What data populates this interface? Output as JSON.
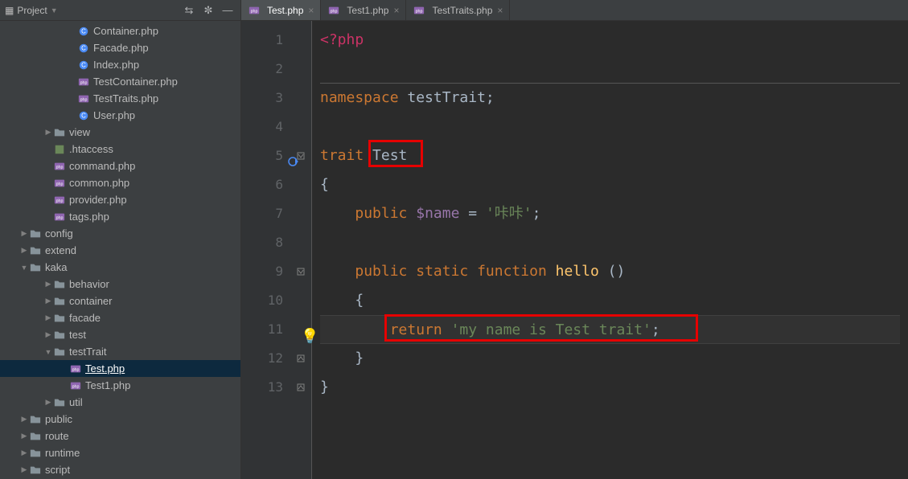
{
  "sidebar": {
    "title": "Project",
    "tree": [
      {
        "indent": 80,
        "icon": "class",
        "label": "Container.php",
        "arrow": ""
      },
      {
        "indent": 80,
        "icon": "class",
        "label": "Facade.php",
        "arrow": ""
      },
      {
        "indent": 80,
        "icon": "class",
        "label": "Index.php",
        "arrow": ""
      },
      {
        "indent": 80,
        "icon": "php",
        "label": "TestContainer.php",
        "arrow": ""
      },
      {
        "indent": 80,
        "icon": "php",
        "label": "TestTraits.php",
        "arrow": ""
      },
      {
        "indent": 80,
        "icon": "class",
        "label": "User.php",
        "arrow": ""
      },
      {
        "indent": 50,
        "icon": "folder",
        "label": "view",
        "arrow": "▶"
      },
      {
        "indent": 50,
        "icon": "htaccess",
        "label": ".htaccess",
        "arrow": ""
      },
      {
        "indent": 50,
        "icon": "php",
        "label": "command.php",
        "arrow": ""
      },
      {
        "indent": 50,
        "icon": "php",
        "label": "common.php",
        "arrow": ""
      },
      {
        "indent": 50,
        "icon": "php",
        "label": "provider.php",
        "arrow": ""
      },
      {
        "indent": 50,
        "icon": "php",
        "label": "tags.php",
        "arrow": ""
      },
      {
        "indent": 20,
        "icon": "folder",
        "label": "config",
        "arrow": "▶"
      },
      {
        "indent": 20,
        "icon": "folder",
        "label": "extend",
        "arrow": "▶"
      },
      {
        "indent": 20,
        "icon": "folder",
        "label": "kaka",
        "arrow": "▼"
      },
      {
        "indent": 50,
        "icon": "folder",
        "label": "behavior",
        "arrow": "▶"
      },
      {
        "indent": 50,
        "icon": "folder",
        "label": "container",
        "arrow": "▶"
      },
      {
        "indent": 50,
        "icon": "folder",
        "label": "facade",
        "arrow": "▶"
      },
      {
        "indent": 50,
        "icon": "folder",
        "label": "test",
        "arrow": "▶"
      },
      {
        "indent": 50,
        "icon": "folder",
        "label": "testTrait",
        "arrow": "▼"
      },
      {
        "indent": 70,
        "icon": "php",
        "label": "Test.php",
        "arrow": "",
        "selected": true,
        "underline": true
      },
      {
        "indent": 70,
        "icon": "php",
        "label": "Test1.php",
        "arrow": ""
      },
      {
        "indent": 50,
        "icon": "folder",
        "label": "util",
        "arrow": "▶"
      },
      {
        "indent": 20,
        "icon": "folder",
        "label": "public",
        "arrow": "▶"
      },
      {
        "indent": 20,
        "icon": "folder",
        "label": "route",
        "arrow": "▶"
      },
      {
        "indent": 20,
        "icon": "folder",
        "label": "runtime",
        "arrow": "▶"
      },
      {
        "indent": 20,
        "icon": "folder",
        "label": "script",
        "arrow": "▶"
      }
    ]
  },
  "tabs": [
    {
      "label": "Test.php",
      "active": true
    },
    {
      "label": "Test1.php",
      "active": false
    },
    {
      "label": "TestTraits.php",
      "active": false
    }
  ],
  "gutter": [
    "1",
    "2",
    "3",
    "4",
    "5",
    "6",
    "7",
    "8",
    "9",
    "10",
    "11",
    "12",
    "13"
  ],
  "code": {
    "l1_open": "<?php",
    "l3_ns": "namespace",
    "l3_name": " testTrait;",
    "l5_kw": "trait",
    "l5_name": " Test",
    "l6_brace": "{",
    "l7_pub": "public",
    "l7_var": " $name",
    "l7_eq": " = ",
    "l7_str": "'咔咔'",
    "l7_sc": ";",
    "l9_pub": "public",
    "l9_static": " static",
    "l9_func": " function",
    "l9_name": " hello",
    "l9_paren": " ()",
    "l10_brace": "{",
    "l11_ret": "return",
    "l11_str": " 'my name is Test trait'",
    "l11_sc": ";",
    "l12_brace": "}",
    "l13_brace": "}"
  }
}
